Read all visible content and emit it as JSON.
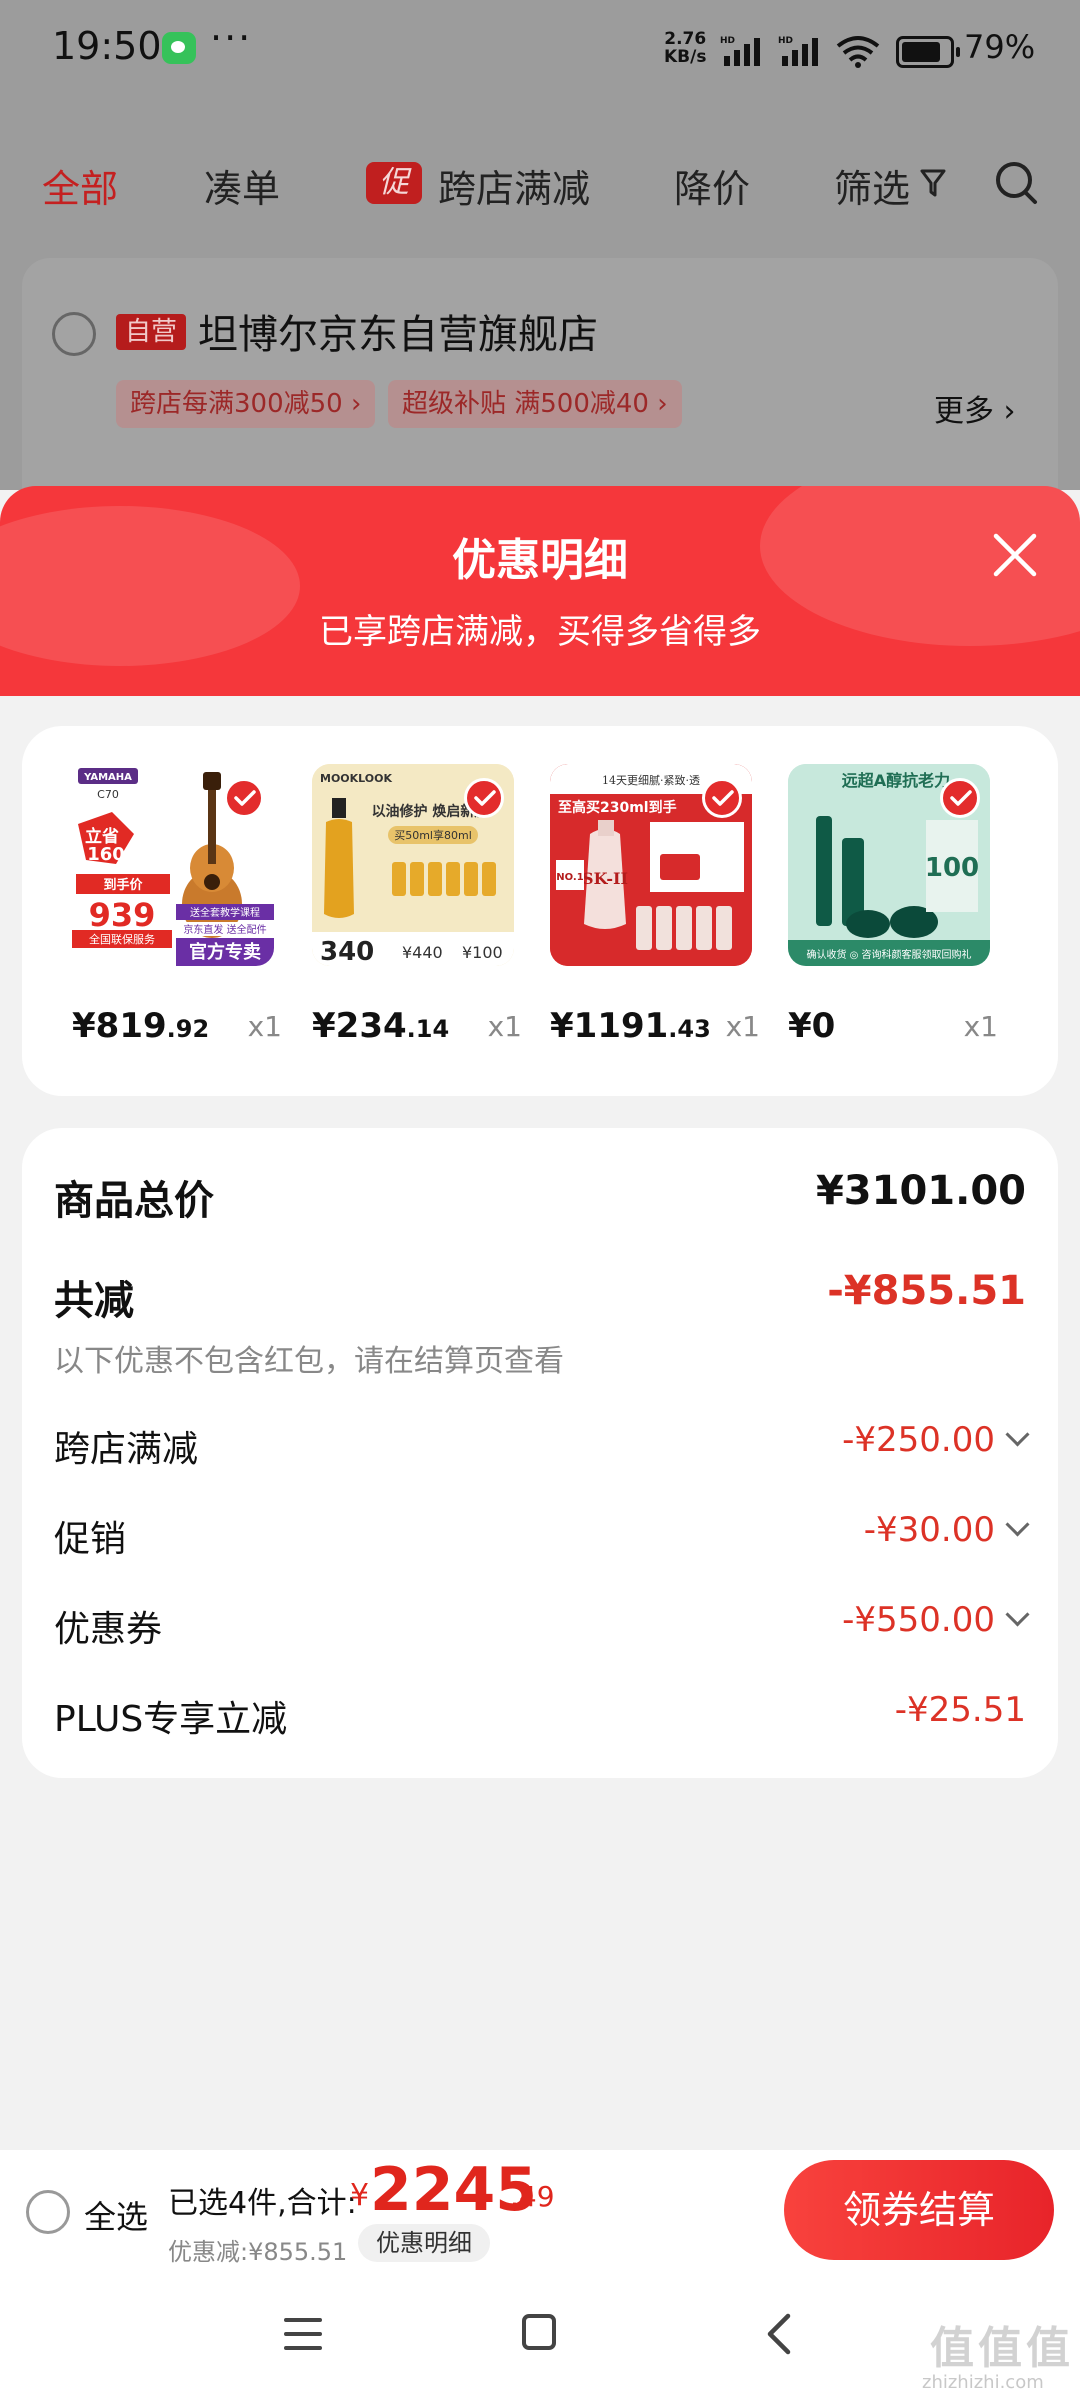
{
  "status_bar": {
    "time": "19:50",
    "dots": "···",
    "net_speed_value": "2.76",
    "net_speed_unit": "KB/s",
    "battery": "79%",
    "icons": [
      "wechat-icon",
      "signal-icon",
      "wifi-icon",
      "battery-icon"
    ]
  },
  "background_page": {
    "tabs": [
      {
        "label": "全部",
        "active": true
      },
      {
        "label": "凑单"
      },
      {
        "label": "跨店满减",
        "tag": "促"
      },
      {
        "label": "降价"
      },
      {
        "label": "筛选"
      }
    ],
    "store": {
      "badge": "自营",
      "name": "坦博尔京东自营旗舰店",
      "coupons": [
        "跨店每满300减50 ›",
        "超级补贴 满500减40 ›"
      ],
      "more": "更多 ›"
    }
  },
  "sheet": {
    "title": "优惠明细",
    "subtitle": "已享跨店满减，买得多省得多",
    "products": [
      {
        "price_int": "¥819",
        "price_dec": ".92",
        "qty": "x1",
        "thumb_text": [
          "YAMAHA",
          "C70",
          "立省",
          "160",
          "到手价",
          "939",
          "送全套教学课程",
          "京东直发 送全配件",
          "全国联保服务",
          "官方专卖"
        ]
      },
      {
        "price_int": "¥234",
        "price_dec": ".14",
        "qty": "x1",
        "thumb_text": [
          "MOOKLOOK",
          "以油修护 焕启新肌",
          "买50ml享80ml",
          "340",
          "¥440",
          "¥100"
        ]
      },
      {
        "price_int": "¥1191",
        "price_dec": ".43",
        "qty": "x1",
        "thumb_text": [
          "14天更细腻·紧致·透",
          "至高买230ml到手",
          "SK-II",
          "NO.1"
        ]
      },
      {
        "price_int": "¥0",
        "price_dec": "",
        "qty": "x1",
        "thumb_text": [
          "远超A醇抗老力",
          "100",
          "确认收货 ◎ 咨询科颜客服领取回购礼"
        ]
      }
    ],
    "summary": {
      "total_label": "商品总价",
      "total_value": "¥3101.00",
      "reduce_label": "共减",
      "reduce_value": "-¥855.51",
      "note": "以下优惠不包含红包，请在结算页查看",
      "items": [
        {
          "label": "跨店满减",
          "value": "-¥250.00",
          "expandable": true
        },
        {
          "label": "促销",
          "value": "-¥30.00",
          "expandable": true
        },
        {
          "label": "优惠券",
          "value": "-¥550.00",
          "expandable": true
        },
        {
          "label": "PLUS专享立减",
          "value": "-¥25.51",
          "expandable": false
        }
      ]
    }
  },
  "checkout": {
    "select_all": "全选",
    "selected_prefix": "已选4件,合计:",
    "currency": "¥",
    "total_int": "2245",
    "total_dec": ".49",
    "discount": "优惠减:¥855.51",
    "detail_button": "优惠明细",
    "checkout_button": "领券结算"
  },
  "watermark": {
    "text": "值值值",
    "url": "zhizhizhi.com"
  },
  "colors": {
    "accent_red": "#f5373b",
    "price_red": "#dc3226",
    "overlay_gray": "#9c9c9c"
  }
}
